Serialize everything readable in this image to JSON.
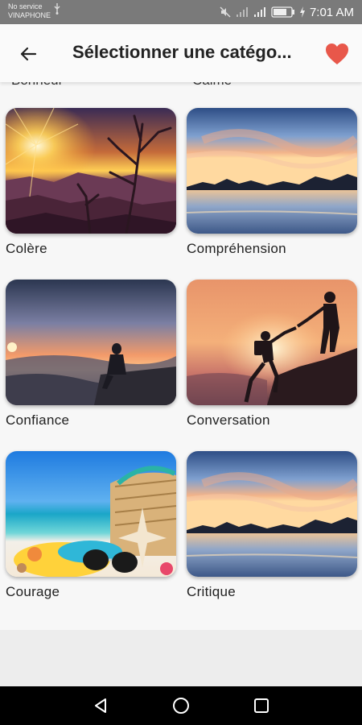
{
  "status_bar": {
    "carrier_line1": "No service",
    "carrier_line2": "VINAPHONE",
    "time": "7:01 AM"
  },
  "app_bar": {
    "title": "Sélectionner une catégo...",
    "back_icon": "arrow-left-icon",
    "favorite_icon": "heart-icon",
    "accent_color": "#e8574a"
  },
  "partial_labels": [
    "Bonheur",
    "Calme"
  ],
  "categories": [
    {
      "label": "Colère",
      "image": "canyon-sunset"
    },
    {
      "label": "Compréhension",
      "image": "lake-sunset"
    },
    {
      "label": "Confiance",
      "image": "woman-clifftop"
    },
    {
      "label": "Conversation",
      "image": "climbers-helping-hand"
    },
    {
      "label": "Courage",
      "image": "beach-sunglasses"
    },
    {
      "label": "Critique",
      "image": "lake-sunset"
    }
  ],
  "nav_bar": {
    "back_icon": "triangle-back-icon",
    "home_icon": "circle-home-icon",
    "recents_icon": "square-recents-icon"
  }
}
